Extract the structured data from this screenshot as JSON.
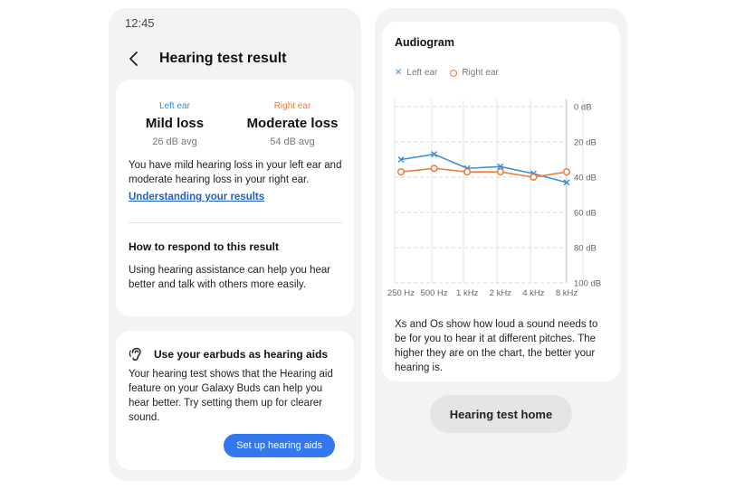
{
  "status_bar": {
    "time": "12:45"
  },
  "header": {
    "title": "Hearing test result"
  },
  "summary": {
    "left_ear": {
      "label": "Left ear",
      "result": "Mild loss",
      "avg": "26 dB avg"
    },
    "right_ear": {
      "label": "Right ear",
      "result": "Moderate loss",
      "avg": "54 dB avg"
    },
    "description": "You have mild hearing loss in your left ear and moderate hearing loss in your right ear.",
    "link": "Understanding your results",
    "respond_heading": "How to respond to this result",
    "respond_text": "Using hearing assistance can help you hear better and talk with others more easily."
  },
  "earbuds": {
    "title": "Use your earbuds as hearing aids",
    "text": "Your hearing test shows that the Hearing aid feature on your Galaxy Buds can help you hear better. Try setting them up for clearer sound.",
    "button": "Set up hearing aids"
  },
  "audiogram": {
    "title": "Audiogram",
    "caption": "Xs and Os show how loud a sound needs to be for you to hear it at different pitches. The higher they are on the chart, the better your hearing is."
  },
  "footer": {
    "home_button": "Hearing test home"
  },
  "colors": {
    "left": "#3a8fd9",
    "right": "#f07b35",
    "accent": "#3478f0"
  },
  "chart_data": {
    "type": "line",
    "title": "Audiogram",
    "categories": [
      "250 Hz",
      "500 Hz",
      "1 kHz",
      "2 kHz",
      "4 kHz",
      "8 kHz"
    ],
    "y_ticks": [
      "0 dB",
      "20 dB",
      "40 dB",
      "60 dB",
      "80 dB",
      "100 dB"
    ],
    "ylim": [
      0,
      100
    ],
    "y_inverted": true,
    "y_axis_position": "right",
    "legend_position": "top-left",
    "series": [
      {
        "name": "Left ear",
        "marker": "x",
        "values": [
          30,
          27,
          35,
          34,
          38,
          43
        ]
      },
      {
        "name": "Right ear",
        "marker": "o",
        "values": [
          37,
          35,
          37,
          37,
          40,
          37
        ]
      }
    ]
  }
}
